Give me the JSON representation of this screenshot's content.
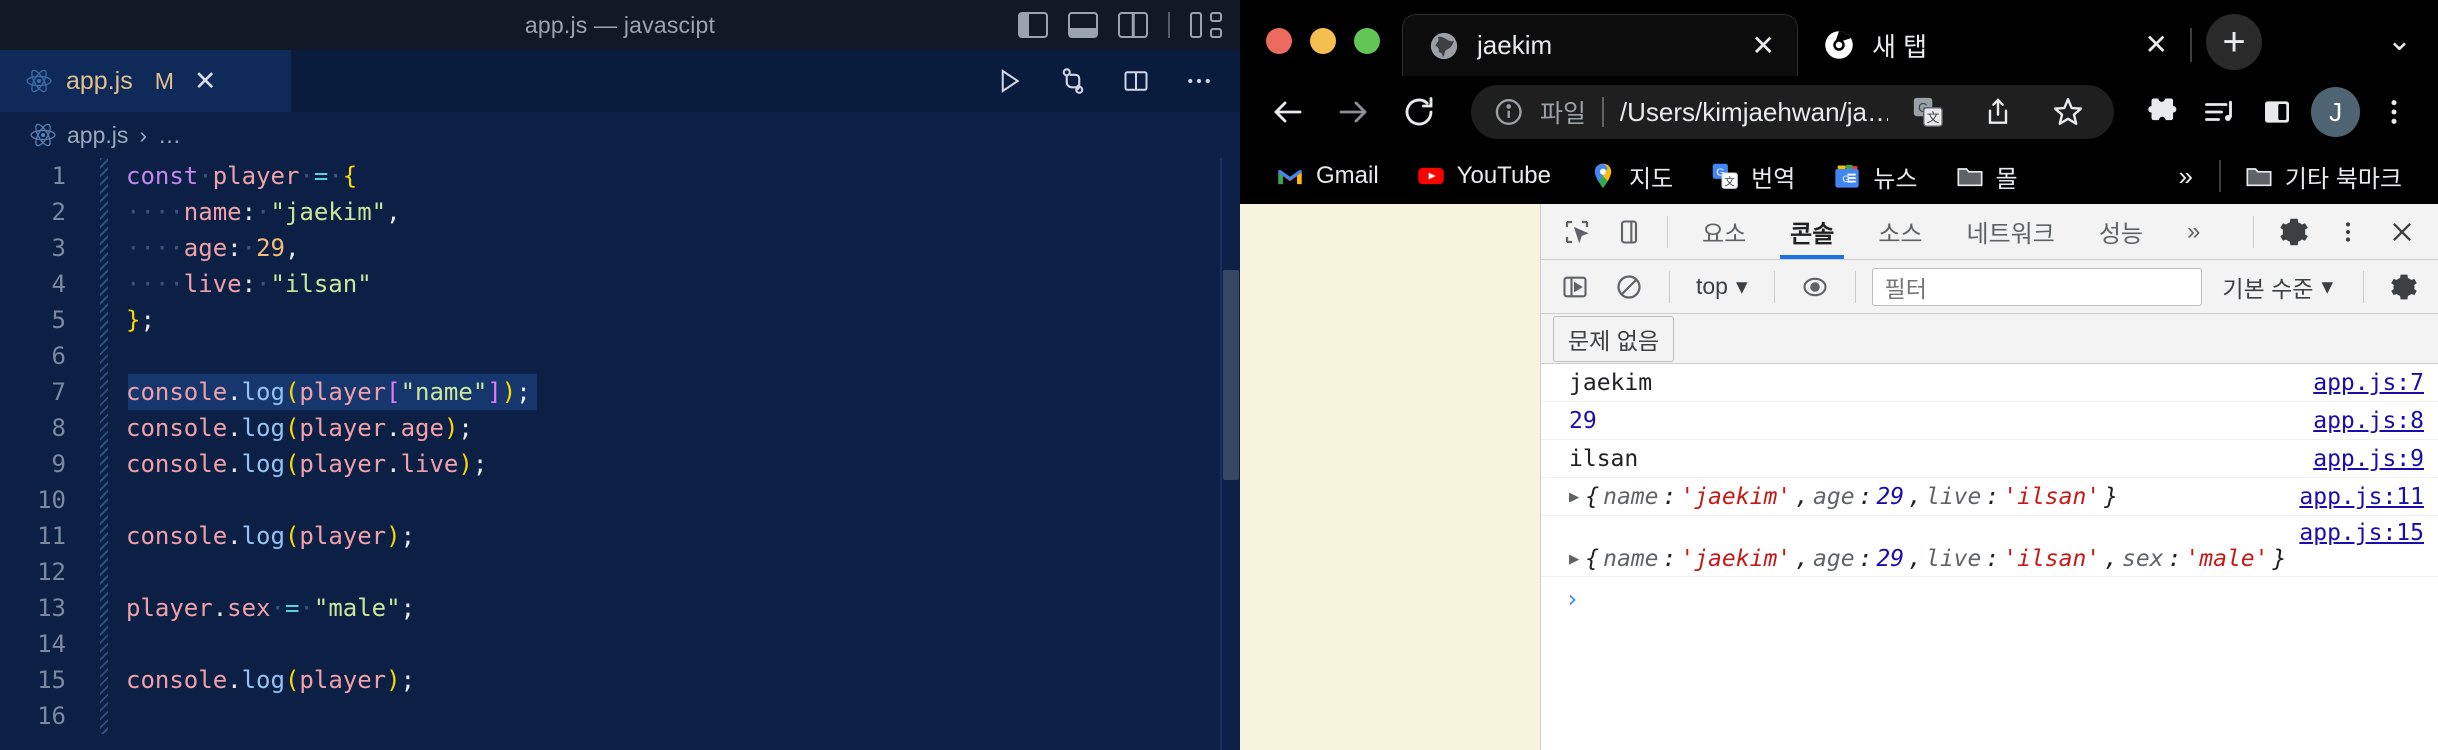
{
  "vscode": {
    "window_title": "app.js — javascipt",
    "layout_icons": [
      "primary-sidebar-toggle",
      "panel-toggle",
      "secondary-sidebar-toggle",
      "customize-layout"
    ],
    "tab": {
      "filename": "app.js",
      "modified_badge": "M",
      "close": "✕",
      "icon": "react-js-file-icon"
    },
    "editor_actions": [
      "run-code",
      "source-control-graph",
      "split-editor",
      "more-actions"
    ],
    "breadcrumb": {
      "file": "app.js",
      "chevron": "›",
      "more": "…"
    },
    "code_lines": [
      {
        "n": "1",
        "tokens": [
          {
            "t": "const",
            "c": "kw"
          },
          {
            "t": " ",
            "c": "ws"
          },
          {
            "t": "player",
            "c": "var"
          },
          {
            "t": " ",
            "c": "ws"
          },
          {
            "t": "=",
            "c": "op"
          },
          {
            "t": " ",
            "c": "ws"
          },
          {
            "t": "{",
            "c": "brace"
          }
        ]
      },
      {
        "n": "2",
        "tokens": [
          {
            "t": "    ",
            "c": "wsdot"
          },
          {
            "t": "name",
            "c": "prop"
          },
          {
            "t": ":",
            "c": "punc"
          },
          {
            "t": " ",
            "c": "ws"
          },
          {
            "t": "\"jaekim\"",
            "c": "str"
          },
          {
            "t": ",",
            "c": "punc"
          }
        ]
      },
      {
        "n": "3",
        "tokens": [
          {
            "t": "    ",
            "c": "wsdot"
          },
          {
            "t": "age",
            "c": "prop"
          },
          {
            "t": ":",
            "c": "punc"
          },
          {
            "t": " ",
            "c": "ws"
          },
          {
            "t": "29",
            "c": "num"
          },
          {
            "t": ",",
            "c": "punc"
          }
        ]
      },
      {
        "n": "4",
        "tokens": [
          {
            "t": "    ",
            "c": "wsdot"
          },
          {
            "t": "live",
            "c": "prop"
          },
          {
            "t": ":",
            "c": "punc"
          },
          {
            "t": " ",
            "c": "ws"
          },
          {
            "t": "\"ilsan\"",
            "c": "str"
          }
        ]
      },
      {
        "n": "5",
        "tokens": [
          {
            "t": "}",
            "c": "brace"
          },
          {
            "t": ";",
            "c": "punc"
          }
        ]
      },
      {
        "n": "6",
        "tokens": []
      },
      {
        "n": "7",
        "highlight": true,
        "hl_width": 290,
        "tokens": [
          {
            "t": "console",
            "c": "var"
          },
          {
            "t": ".",
            "c": "dot"
          },
          {
            "t": "log",
            "c": "fn"
          },
          {
            "t": "(",
            "c": "brace"
          },
          {
            "t": "player",
            "c": "var"
          },
          {
            "t": "[",
            "c": "bracket"
          },
          {
            "t": "\"name\"",
            "c": "str"
          },
          {
            "t": "]",
            "c": "bracket"
          },
          {
            "t": ")",
            "c": "brace"
          },
          {
            "t": ";",
            "c": "punc"
          }
        ]
      },
      {
        "n": "8",
        "tokens": [
          {
            "t": "console",
            "c": "var"
          },
          {
            "t": ".",
            "c": "dot"
          },
          {
            "t": "log",
            "c": "fn"
          },
          {
            "t": "(",
            "c": "brace"
          },
          {
            "t": "player",
            "c": "var"
          },
          {
            "t": ".",
            "c": "dot"
          },
          {
            "t": "age",
            "c": "prop"
          },
          {
            "t": ")",
            "c": "brace"
          },
          {
            "t": ";",
            "c": "punc"
          }
        ]
      },
      {
        "n": "9",
        "tokens": [
          {
            "t": "console",
            "c": "var"
          },
          {
            "t": ".",
            "c": "dot"
          },
          {
            "t": "log",
            "c": "fn"
          },
          {
            "t": "(",
            "c": "brace"
          },
          {
            "t": "player",
            "c": "var"
          },
          {
            "t": ".",
            "c": "dot"
          },
          {
            "t": "live",
            "c": "prop"
          },
          {
            "t": ")",
            "c": "brace"
          },
          {
            "t": ";",
            "c": "punc"
          }
        ]
      },
      {
        "n": "10",
        "tokens": []
      },
      {
        "n": "11",
        "tokens": [
          {
            "t": "console",
            "c": "var"
          },
          {
            "t": ".",
            "c": "dot"
          },
          {
            "t": "log",
            "c": "fn"
          },
          {
            "t": "(",
            "c": "brace"
          },
          {
            "t": "player",
            "c": "var"
          },
          {
            "t": ")",
            "c": "brace"
          },
          {
            "t": ";",
            "c": "punc"
          }
        ]
      },
      {
        "n": "12",
        "tokens": []
      },
      {
        "n": "13",
        "tokens": [
          {
            "t": "player",
            "c": "var"
          },
          {
            "t": ".",
            "c": "dot"
          },
          {
            "t": "sex",
            "c": "prop"
          },
          {
            "t": " ",
            "c": "ws"
          },
          {
            "t": "=",
            "c": "op"
          },
          {
            "t": " ",
            "c": "ws"
          },
          {
            "t": "\"male\"",
            "c": "str"
          },
          {
            "t": ";",
            "c": "punc"
          }
        ]
      },
      {
        "n": "14",
        "tokens": []
      },
      {
        "n": "15",
        "tokens": [
          {
            "t": "console",
            "c": "var"
          },
          {
            "t": ".",
            "c": "dot"
          },
          {
            "t": "log",
            "c": "fn"
          },
          {
            "t": "(",
            "c": "brace"
          },
          {
            "t": "player",
            "c": "var"
          },
          {
            "t": ")",
            "c": "brace"
          },
          {
            "t": ";",
            "c": "punc"
          }
        ]
      },
      {
        "n": "16",
        "tokens": []
      }
    ]
  },
  "chrome": {
    "traffic_lights": [
      "close",
      "minimize",
      "maximize"
    ],
    "tabs": [
      {
        "title": "jaekim",
        "icon": "globe-icon",
        "active": true,
        "close": "✕"
      },
      {
        "title": "새 탭",
        "icon": "chrome-icon",
        "active": false,
        "close": "✕"
      }
    ],
    "new_tab_label": "+",
    "tab_list_chevron": "⌄",
    "toolbar": {
      "back": "←",
      "forward": "→",
      "reload": "⟳",
      "omnibox_scheme": "파일",
      "omnibox_url": "/Users/kimjaehwan/ja…",
      "icons": [
        "translate-icon",
        "share-icon",
        "bookmark-star-icon",
        "extensions-icon",
        "media-control-icon",
        "side-panel-icon"
      ],
      "avatar_letter": "J",
      "menu": "⋮"
    },
    "bookmarks": [
      {
        "label": "Gmail",
        "icon": "gmail-icon"
      },
      {
        "label": "YouTube",
        "icon": "youtube-icon"
      },
      {
        "label": "지도",
        "icon": "maps-icon"
      },
      {
        "label": "번역",
        "icon": "translate-icon"
      },
      {
        "label": "뉴스",
        "icon": "news-icon"
      },
      {
        "label": "몰",
        "icon": "folder-icon"
      }
    ],
    "bookmarks_overflow": "»",
    "other_bookmarks": {
      "label": "기타 북마크",
      "icon": "folder-icon"
    }
  },
  "devtools": {
    "tabs": [
      {
        "label": "요소",
        "active": false
      },
      {
        "label": "콘솔",
        "active": true
      },
      {
        "label": "소스",
        "active": false
      },
      {
        "label": "네트워크",
        "active": false
      },
      {
        "label": "성능",
        "active": false
      }
    ],
    "tabs_overflow": "»",
    "left_icons": [
      "inspect-element-icon",
      "device-toolbar-icon"
    ],
    "right_icons": [
      "settings-gear-icon",
      "more-options-icon",
      "close-devtools-icon"
    ],
    "filterbar": {
      "sidebar_toggle": "console-sidebar-icon",
      "clear_console": "clear-console-icon",
      "context": "top",
      "context_caret": "▾",
      "live_expression": "eye-icon",
      "filter_placeholder": "필터",
      "levels": "기본 수준",
      "levels_caret": "▾",
      "settings": "settings-gear-icon"
    },
    "issues_label": "문제 없음",
    "console_rows": [
      {
        "kind": "string",
        "text": "jaekim",
        "source": "app.js:7"
      },
      {
        "kind": "number",
        "text": "29",
        "source": "app.js:8"
      },
      {
        "kind": "string",
        "text": "ilsan",
        "source": "app.js:9"
      },
      {
        "kind": "object",
        "expandable": true,
        "source": "app.js:11",
        "parts": [
          {
            "t": "{",
            "c": "br"
          },
          {
            "t": "name",
            "c": "k"
          },
          {
            "t": ": ",
            "c": "br"
          },
          {
            "t": "'jaekim'",
            "c": "s"
          },
          {
            "t": ", ",
            "c": "br"
          },
          {
            "t": "age",
            "c": "k"
          },
          {
            "t": ": ",
            "c": "br"
          },
          {
            "t": "29",
            "c": "n"
          },
          {
            "t": ", ",
            "c": "br"
          },
          {
            "t": "live",
            "c": "k"
          },
          {
            "t": ": ",
            "c": "br"
          },
          {
            "t": "'ilsan'",
            "c": "s"
          },
          {
            "t": "}",
            "c": "br"
          }
        ]
      },
      {
        "kind": "object",
        "expandable": true,
        "source": "app.js:15",
        "source_above": true,
        "parts": [
          {
            "t": "{",
            "c": "br"
          },
          {
            "t": "name",
            "c": "k"
          },
          {
            "t": ": ",
            "c": "br"
          },
          {
            "t": "'jaekim'",
            "c": "s"
          },
          {
            "t": ", ",
            "c": "br"
          },
          {
            "t": "age",
            "c": "k"
          },
          {
            "t": ": ",
            "c": "br"
          },
          {
            "t": "29",
            "c": "n"
          },
          {
            "t": ", ",
            "c": "br"
          },
          {
            "t": "live",
            "c": "k"
          },
          {
            "t": ": ",
            "c": "br"
          },
          {
            "t": "'ilsan'",
            "c": "s"
          },
          {
            "t": ", ",
            "c": "br"
          },
          {
            "t": "sex",
            "c": "k"
          },
          {
            "t": ": ",
            "c": "br"
          },
          {
            "t": "'male'",
            "c": "s"
          },
          {
            "t": "}",
            "c": "br"
          }
        ]
      }
    ],
    "prompt_chevron": "›"
  },
  "colors": {
    "vscode_bg": "#0b2044",
    "vscode_titlebar": "#111826",
    "vscode_tab_active": "#0f2a58",
    "chrome_bg": "#000000",
    "devtools_bg": "#ffffff",
    "devtools_active_tab": "#1a73e8",
    "page_bg": "#f7f4dd"
  }
}
